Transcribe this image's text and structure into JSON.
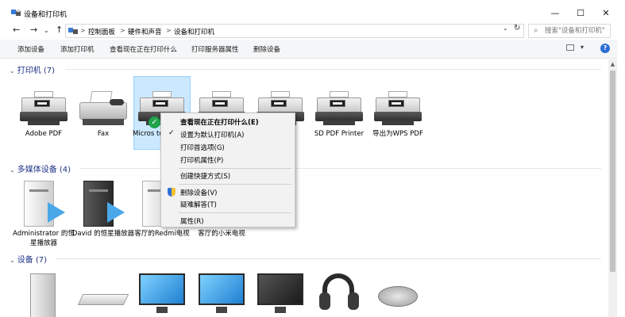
{
  "window": {
    "title": "设备和打印机",
    "minimize": "—",
    "maximize": "☐",
    "close": "✕"
  },
  "address": {
    "back": "←",
    "forward": "→",
    "history": "⌄",
    "up": "↑",
    "breadcrumb": [
      "控制面板",
      "硬件和声音",
      "设备和打印机"
    ],
    "separator": ">",
    "dropdown": "⌄",
    "refresh": "↻",
    "search_placeholder": "搜索\"设备和打印机\""
  },
  "toolbar": {
    "items": [
      "添加设备",
      "添加打印机",
      "查看现在正在打印什么",
      "打印服务器属性",
      "删除设备"
    ],
    "view_dropdown": "▾",
    "help": "?"
  },
  "groups": {
    "printers": {
      "header": "打印机 (7)",
      "items": [
        {
          "label": "Adobe PDF"
        },
        {
          "label": "Fax"
        },
        {
          "label": "Micros to"
        },
        {
          "label": ""
        },
        {
          "label": ""
        },
        {
          "label": "SD PDF Printer"
        },
        {
          "label": "导出为WPS PDF"
        }
      ]
    },
    "multimedia": {
      "header": "多媒体设备 (4)",
      "items": [
        {
          "label": "Administrator 的恒星播放器"
        },
        {
          "label": "David 的恒星播放器"
        },
        {
          "label": "客厅的Redmi电视"
        },
        {
          "label": "客厅的小米电视"
        }
      ]
    },
    "devices": {
      "header": "设备 (7)"
    }
  },
  "context_menu": {
    "items": [
      {
        "label": "查看现在正在打印什么(E)",
        "bold": true
      },
      {
        "label": "设置为默认打印机(A)",
        "checked": true
      },
      {
        "label": "打印首选项(G)"
      },
      {
        "label": "打印机属性(P)"
      },
      {
        "label": "创建快捷方式(S)"
      },
      {
        "label": "删除设备(V)",
        "shield": true
      },
      {
        "label": "疑难解答(T)"
      },
      {
        "label": "属性(R)"
      }
    ]
  },
  "colors": {
    "group_header": "#1e3287",
    "selection_fill": "#cce8ff",
    "default_check": "#1fa34a"
  }
}
